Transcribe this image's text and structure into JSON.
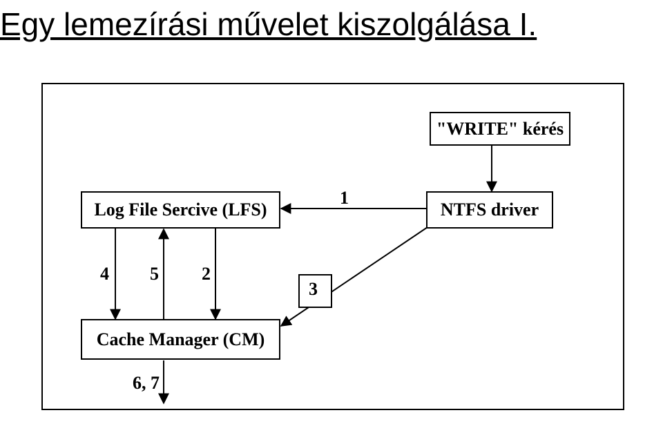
{
  "title": "Egy lemezírási művelet kiszolgálása I.",
  "boxes": {
    "write": "\"WRITE\" kérés",
    "lfs": "Log File Sercive (LFS)",
    "ntfs": "NTFS driver",
    "cache": "Cache Manager (CM)"
  },
  "labels": {
    "n1": "1",
    "n2": "2",
    "n3": "3",
    "n4": "4",
    "n5": "5",
    "n67": "6, 7"
  }
}
